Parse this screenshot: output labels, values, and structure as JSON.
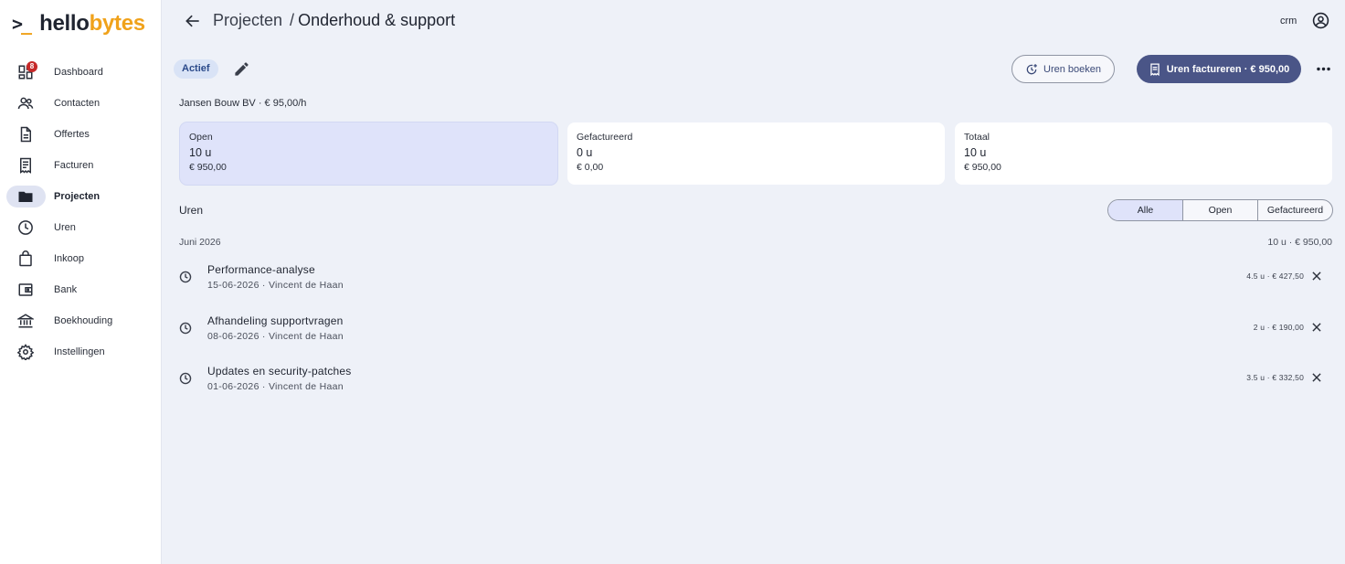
{
  "brand": {
    "prompt": ">",
    "underscore": "_",
    "name_a": "hello",
    "name_b": "bytes",
    "accent": "#f0a21b"
  },
  "sidebar": {
    "items": [
      {
        "label": "Dashboard",
        "icon": "dashboard-icon",
        "badge": "8"
      },
      {
        "label": "Contacten",
        "icon": "people-icon"
      },
      {
        "label": "Offertes",
        "icon": "document-icon"
      },
      {
        "label": "Facturen",
        "icon": "receipt-icon"
      },
      {
        "label": "Projecten",
        "icon": "folder-icon",
        "active": true
      },
      {
        "label": "Uren",
        "icon": "clock-icon"
      },
      {
        "label": "Inkoop",
        "icon": "shopping-bag-icon"
      },
      {
        "label": "Bank",
        "icon": "wallet-icon"
      },
      {
        "label": "Boekhouding",
        "icon": "bank-icon"
      },
      {
        "label": "Instellingen",
        "icon": "gear-icon"
      }
    ]
  },
  "header": {
    "breadcrumb_parent": "Projecten",
    "breadcrumb_sep": "/",
    "breadcrumb_current": "Onderhoud & support",
    "crm_label": "crm"
  },
  "project": {
    "status": "Actief",
    "client_line": "Jansen Bouw BV · € 95,00/h",
    "book_hours_label": "Uren boeken",
    "invoice_hours_label": "Uren factureren · € 950,00"
  },
  "cards": [
    {
      "label": "Open",
      "hours": "10 u",
      "amount": "€ 950,00",
      "selected": true
    },
    {
      "label": "Gefactureerd",
      "hours": "0 u",
      "amount": "€ 0,00"
    },
    {
      "label": "Totaal",
      "hours": "10 u",
      "amount": "€ 950,00"
    }
  ],
  "hours_section": {
    "title": "Uren",
    "filters": [
      {
        "label": "Alle",
        "selected": true
      },
      {
        "label": "Open"
      },
      {
        "label": "Gefactureerd"
      }
    ],
    "month_label": "Juni 2026",
    "month_total": "10 u · € 950,00",
    "entries": [
      {
        "title": "Performance-analyse",
        "subtitle": "15-06-2026 · Vincent de Haan",
        "amount": "4.5 u · € 427,50"
      },
      {
        "title": "Afhandeling supportvragen",
        "subtitle": "08-06-2026 · Vincent de Haan",
        "amount": "2 u · € 190,00"
      },
      {
        "title": "Updates en security-patches",
        "subtitle": "01-06-2026 · Vincent de Haan",
        "amount": "3.5 u · € 332,50"
      }
    ]
  },
  "colors": {
    "primary": "#4a5587",
    "selected_bg": "#dfe3fa",
    "badge": "#c62828",
    "page_bg": "#eef1f8"
  }
}
